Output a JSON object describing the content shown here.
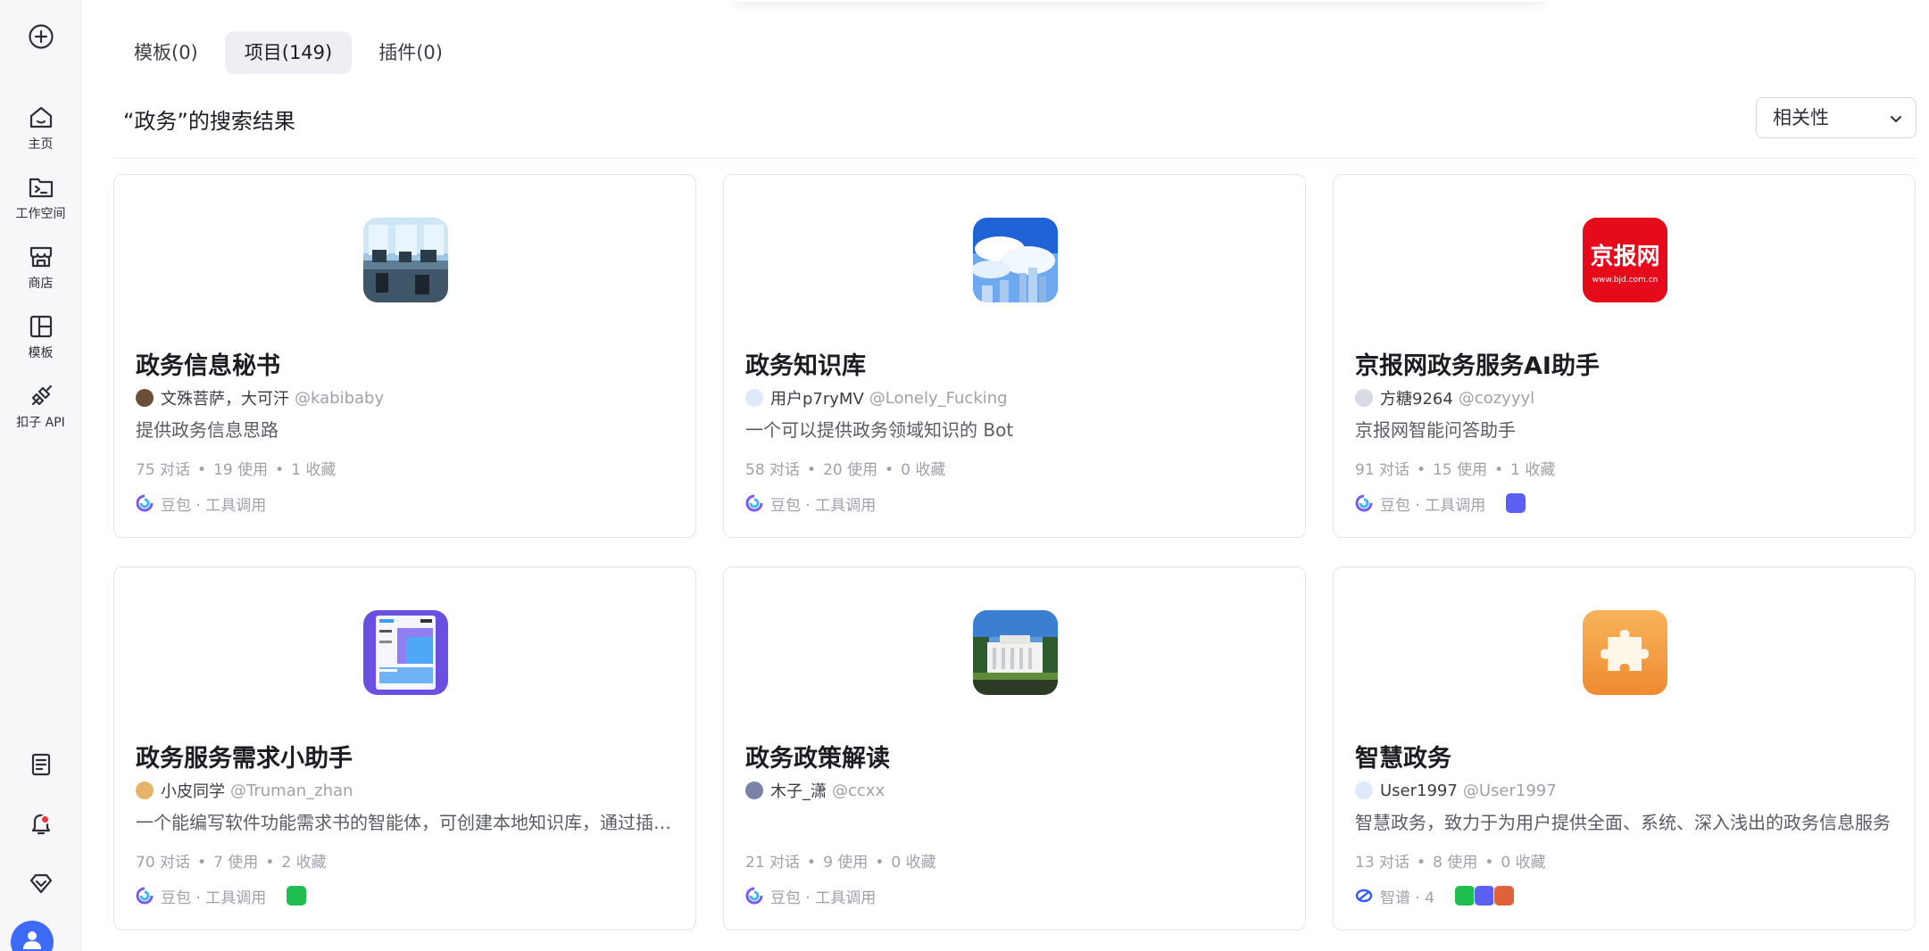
{
  "sidebar": {
    "items": [
      {
        "label": "主页",
        "icon": "home-icon"
      },
      {
        "label": "工作空间",
        "icon": "terminal-folder-icon"
      },
      {
        "label": "商店",
        "icon": "store-icon"
      },
      {
        "label": "模板",
        "icon": "template-icon"
      },
      {
        "label": "扣子 API",
        "icon": "api-icon"
      }
    ],
    "bottom_icons": [
      "document-icon",
      "bell-icon",
      "gem-icon",
      "user-avatar-icon"
    ]
  },
  "tabs": [
    {
      "label": "模板(0)",
      "active": false
    },
    {
      "label": "项目(149)",
      "active": true
    },
    {
      "label": "插件(0)",
      "active": false
    }
  ],
  "results": {
    "title": "“政务”的搜索结果",
    "sort_value": "相关性"
  },
  "colors": {
    "accent": "#3d6bf5",
    "notification": "#f0303a",
    "muted_text": "#9fa1ab",
    "border": "#e4e5eb"
  },
  "cards": [
    {
      "title": "政务信息秘书",
      "author": "文殊菩萨，大可汗",
      "handle": "@kabibaby",
      "desc": "提供政务信息思路",
      "stats": {
        "dialogs": "75 对话",
        "uses": "19 使用",
        "favorites": "1 收藏"
      },
      "model": "豆包 · 工具调用",
      "icon": "office-image"
    },
    {
      "title": "政务知识库",
      "author": "用户p7ryMV",
      "handle": "@Lonely_Fucking",
      "desc": "一个可以提供政务领域知识的 Bot",
      "stats": {
        "dialogs": "58 对话",
        "uses": "20 使用",
        "favorites": "0 收藏"
      },
      "model": "豆包 · 工具调用",
      "icon": "sky-city-image"
    },
    {
      "title": "京报网政务服务AI助手",
      "author": "方糖9264",
      "handle": "@cozyyyl",
      "desc": "京报网智能问答助手",
      "stats": {
        "dialogs": "91 对话",
        "uses": "15 使用",
        "favorites": "1 收藏"
      },
      "model": "豆包 · 工具调用",
      "icon": "bjd-logo",
      "logo_text": "京报网",
      "logo_url": "www.bjd.com.cn"
    },
    {
      "title": "政务服务需求小助手",
      "author": "小皮同学",
      "handle": "@Truman_zhan",
      "desc": "一个能编写软件功能需求书的智能体，可创建本地知识库，通过插件帮用户整理需求",
      "stats": {
        "dialogs": "70 对话",
        "uses": "7 使用",
        "favorites": "2 收藏"
      },
      "model": "豆包 · 工具调用",
      "icon": "dashboard-image"
    },
    {
      "title": "政务政策解读",
      "author": "木子_潇",
      "handle": "@ccxx",
      "desc": "",
      "stats": {
        "dialogs": "21 对话",
        "uses": "9 使用",
        "favorites": "0 收藏"
      },
      "model": "豆包 · 工具调用",
      "icon": "building-image"
    },
    {
      "title": "智慧政务",
      "author": "User1997",
      "handle": "@User1997",
      "desc": "智慧政务，致力于为用户提供全面、系统、深入浅出的政务信息服务",
      "stats": {
        "dialogs": "13 对话",
        "uses": "8 使用",
        "favorites": "0 收藏"
      },
      "model": "智谱 · 4",
      "icon": "puzzle-icon"
    }
  ]
}
